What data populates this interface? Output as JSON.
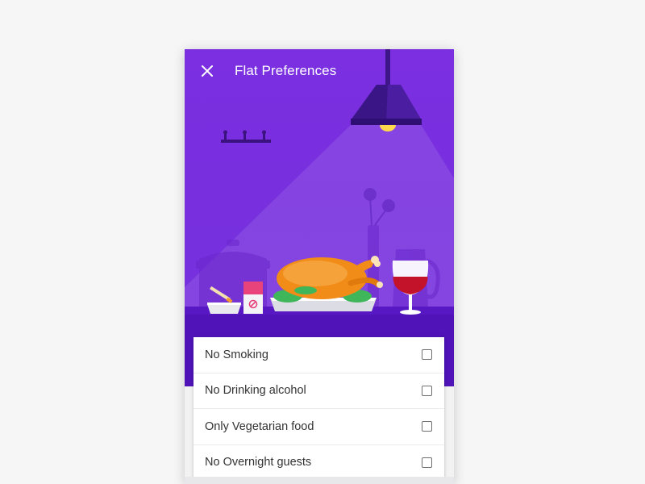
{
  "header": {
    "title": "Flat Preferences",
    "close_icon": "close-icon"
  },
  "preferences": [
    {
      "label": "No Smoking",
      "checked": false
    },
    {
      "label": "No Drinking alcohol",
      "checked": false
    },
    {
      "label": "Only Vegetarian food",
      "checked": false
    },
    {
      "label": "No Overnight guests",
      "checked": false
    }
  ],
  "colors": {
    "hero_purple": "#7b2fe0",
    "counter_dark": "#4f13b8",
    "lamp_dark": "#3f1689",
    "lamp_bulb": "#ffd84d",
    "wine_red": "#c3132b",
    "turkey_orange": "#f28c18",
    "card_white": "#ffffff",
    "page_background": "#f6f6f6"
  }
}
